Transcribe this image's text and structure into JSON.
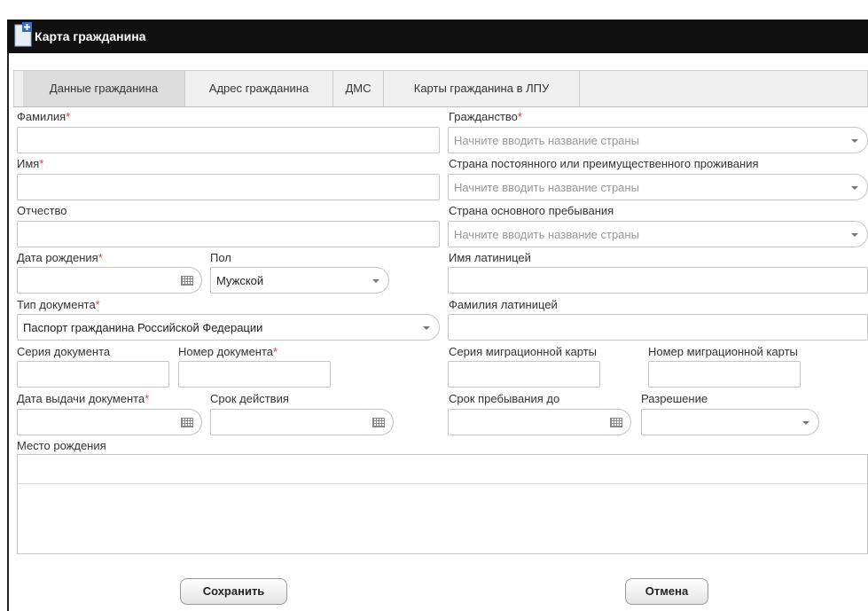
{
  "window": {
    "title": "Карта гражданина"
  },
  "tabs": [
    {
      "label": "Данные гражданина",
      "active": true
    },
    {
      "label": "Адрес гражданина",
      "active": false
    },
    {
      "label": "ДМС",
      "active": false
    },
    {
      "label": "Карты гражданина в ЛПУ",
      "active": false
    }
  ],
  "fields": {
    "surname": {
      "label": "Фамилия",
      "required": "*",
      "value": ""
    },
    "name": {
      "label": "Имя",
      "required": "*",
      "value": ""
    },
    "patronymic": {
      "label": "Отчество",
      "value": ""
    },
    "birth_date": {
      "label": "Дата рождения",
      "required": "*",
      "value": ""
    },
    "sex": {
      "label": "Пол",
      "value": "Мужской"
    },
    "doc_type": {
      "label": "Тип документа",
      "required": "*",
      "value": "Паспорт гражданина Российской Федерации"
    },
    "doc_series": {
      "label": "Серия документа",
      "value": ""
    },
    "doc_number": {
      "label": "Номер документа",
      "required": "*",
      "value": ""
    },
    "doc_issue_date": {
      "label": "Дата выдачи документа",
      "required": "*",
      "value": ""
    },
    "validity": {
      "label": "Срок действия",
      "value": ""
    },
    "birth_place": {
      "label": "Место рождения",
      "value": ""
    },
    "citizenship": {
      "label": "Гражданство",
      "required": "*",
      "placeholder": "Начните вводить название страны"
    },
    "residence_country": {
      "label": "Страна постоянного или преимущественного проживания",
      "placeholder": "Начните вводить название страны"
    },
    "stay_country": {
      "label": "Страна основного пребывания",
      "placeholder": "Начните вводить название страны"
    },
    "latin_name": {
      "label": "Имя латиницей",
      "value": ""
    },
    "latin_surname": {
      "label": "Фамилия латиницей",
      "value": ""
    },
    "migr_series": {
      "label": "Серия миграционной карты",
      "value": ""
    },
    "migr_number": {
      "label": "Номер миграционной карты",
      "value": ""
    },
    "stay_until": {
      "label": "Срок пребывания до",
      "value": ""
    },
    "permit": {
      "label": "Разрешение",
      "value": ""
    }
  },
  "buttons": {
    "save": "Сохранить",
    "cancel": "Отмена"
  },
  "colors": {
    "titlebar": "#111111",
    "required": "#e03a2a",
    "active_tab": "#dcdcdc"
  }
}
